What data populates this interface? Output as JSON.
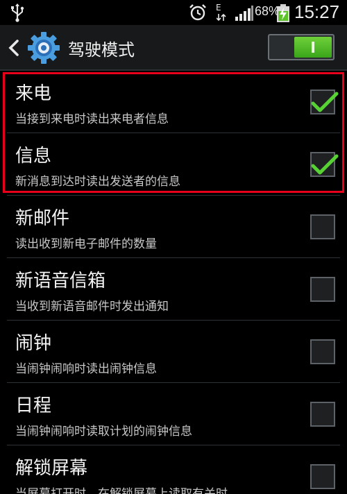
{
  "status_bar": {
    "network_letter": "E",
    "battery_percent": "68%",
    "time": "15:27",
    "icons": [
      "usb-icon",
      "alarm-icon",
      "network-type-icon",
      "signal-icon",
      "battery-charging-icon"
    ]
  },
  "action_bar": {
    "title": "驾驶模式",
    "toggle_on": true,
    "accent_color": "#4dbb22"
  },
  "items": [
    {
      "title": "来电",
      "subtitle": "当接到来电时读出来电者信息",
      "checked": true
    },
    {
      "title": "信息",
      "subtitle": "新消息到达时读出发送者的信息",
      "checked": true
    },
    {
      "title": "新邮件",
      "subtitle": "读出收到新电子邮件的数量",
      "checked": false
    },
    {
      "title": "新语音信箱",
      "subtitle": "当收到新语音邮件时发出通知",
      "checked": false
    },
    {
      "title": "闹钟",
      "subtitle": "当闹钟闹响时读出闹钟信息",
      "checked": false
    },
    {
      "title": "日程",
      "subtitle": "当闹钟闹响时读取计划的闹钟信息",
      "checked": false
    },
    {
      "title": "解锁屏幕",
      "subtitle": "当屏幕打开时，在解锁屏幕上读取有关时",
      "checked": false
    }
  ],
  "highlight_color": "#e8001b"
}
